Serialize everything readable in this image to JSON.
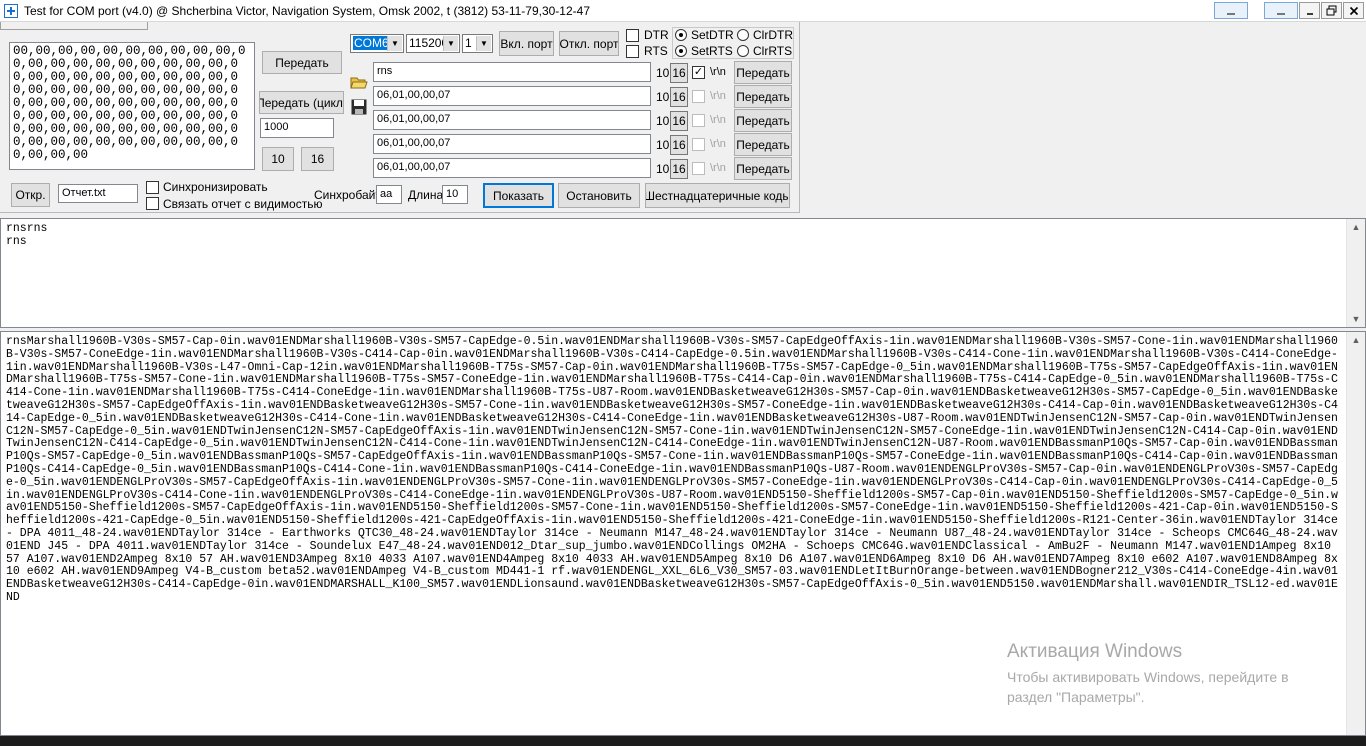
{
  "window": {
    "title": "Test for COM port (v4.0) @ Shcherbina Victor, Navigation System, Omsk 2002, t (3812) 53-11-79,30-12-47",
    "minimize_icon": "minimize-icon",
    "maximize_icon": "maximize-icon",
    "close_icon": "close-icon"
  },
  "send_block": {
    "hex_text": "00,00,00,00,00,00,00,00,00,00,00,00,00,00,00,00,00,00,00,00,00,00,00,00,00,00,00,00,00,00,00,00,00,00,00,00,00,00,00,00,00,00,00,00,00,00,00,00,00,00,00,00,00,00,00,00,00,00,00,00,00,00,00,00,00,00,00,00,00,00,00,00,00,00,00,00,00,00,00,00,00,00,00,00",
    "send_label": "Передать",
    "send_cycle_label": "Передать (цикл)",
    "cycle_interval": "1000",
    "dec_label": "10",
    "hex_label": "16"
  },
  "port": {
    "port_value": "COM6",
    "baud_value": "115200",
    "stopbits_value": "1",
    "connect_label": "Вкл. порт",
    "disconnect_label": "Откл. порт",
    "dtr_label": "DTR",
    "rts_label": "RTS",
    "setdtr_label": "SetDTR",
    "clrdtr_label": "ClrDTR",
    "setrts_label": "SetRTS",
    "clrrts_label": "ClrRTS"
  },
  "lines": {
    "rows": [
      {
        "value": "rns",
        "dec": "10",
        "hex": "16",
        "crlf": "\\r\\n",
        "checked": true,
        "send": "Передать"
      },
      {
        "value": "06,01,00,00,07",
        "dec": "10",
        "hex": "16",
        "crlf": "\\r\\n",
        "checked": false,
        "send": "Передать"
      },
      {
        "value": "06,01,00,00,07",
        "dec": "10",
        "hex": "16",
        "crlf": "\\r\\n",
        "checked": false,
        "send": "Передать"
      },
      {
        "value": "06,01,00,00,07",
        "dec": "10",
        "hex": "16",
        "crlf": "\\r\\n",
        "checked": false,
        "send": "Передать"
      },
      {
        "value": "06,01,00,00,07",
        "dec": "10",
        "hex": "16",
        "crlf": "\\r\\n",
        "checked": false,
        "send": "Передать"
      }
    ],
    "open_icon": "folder-open-icon",
    "save_icon": "floppy-save-icon"
  },
  "bottom_controls": {
    "open_label": "Откр.",
    "report_file": "Отчет.txt",
    "sync_label": "Синхронизировать",
    "link_label": "Связать отчет с видимостью",
    "syncbyte_label": "Синхробайт",
    "syncbyte_value": "aa",
    "length_label": "Длина",
    "length_value": "10",
    "show_label": "Показать",
    "stop_label": "Остановить",
    "hexcodes_label": "Шестнадцатеричные коды"
  },
  "output": {
    "mid_text": "rnsrns\nrns",
    "log_text": "rnsMarshall1960B-V30s-SM57-Cap-0in.wav01ENDMarshall1960B-V30s-SM57-CapEdge-0.5in.wav01ENDMarshall1960B-V30s-SM57-CapEdgeOffAxis-1in.wav01ENDMarshall1960B-V30s-SM57-Cone-1in.wav01ENDMarshall1960B-V30s-SM57-ConeEdge-1in.wav01ENDMarshall1960B-V30s-C414-Cap-0in.wav01ENDMarshall1960B-V30s-C414-CapEdge-0.5in.wav01ENDMarshall1960B-V30s-C414-Cone-1in.wav01ENDMarshall1960B-V30s-C414-ConeEdge-1in.wav01ENDMarshall1960B-V30s-L47-Omni-Cap-12in.wav01ENDMarshall1960B-T75s-SM57-Cap-0in.wav01ENDMarshall1960B-T75s-SM57-CapEdge-0_5in.wav01ENDMarshall1960B-T75s-SM57-CapEdgeOffAxis-1in.wav01ENDMarshall1960B-T75s-SM57-Cone-1in.wav01ENDMarshall1960B-T75s-SM57-ConeEdge-1in.wav01ENDMarshall1960B-T75s-C414-Cap-0in.wav01ENDMarshall1960B-T75s-C414-CapEdge-0_5in.wav01ENDMarshall1960B-T75s-C414-Cone-1in.wav01ENDMarshall1960B-T75s-C414-ConeEdge-1in.wav01ENDMarshall1960B-T75s-U87-Room.wav01ENDBasketweaveG12H30s-SM57-Cap-0in.wav01ENDBasketweaveG12H30s-SM57-CapEdge-0_5in.wav01ENDBasketweaveG12H30s-SM57-CapEdgeOffAxis-1in.wav01ENDBasketweaveG12H30s-SM57-Cone-1in.wav01ENDBasketweaveG12H30s-SM57-ConeEdge-1in.wav01ENDBasketweaveG12H30s-C414-Cap-0in.wav01ENDBasketweaveG12H30s-C414-CapEdge-0_5in.wav01ENDBasketweaveG12H30s-C414-Cone-1in.wav01ENDBasketweaveG12H30s-C414-ConeEdge-1in.wav01ENDBasketweaveG12H30s-U87-Room.wav01ENDTwinJensenC12N-SM57-Cap-0in.wav01ENDTwinJensenC12N-SM57-CapEdge-0_5in.wav01ENDTwinJensenC12N-SM57-CapEdgeOffAxis-1in.wav01ENDTwinJensenC12N-SM57-Cone-1in.wav01ENDTwinJensenC12N-SM57-ConeEdge-1in.wav01ENDTwinJensenC12N-C414-Cap-0in.wav01ENDTwinJensenC12N-C414-CapEdge-0_5in.wav01ENDTwinJensenC12N-C414-Cone-1in.wav01ENDTwinJensenC12N-C414-ConeEdge-1in.wav01ENDTwinJensenC12N-U87-Room.wav01ENDBassmanP10Qs-SM57-Cap-0in.wav01ENDBassmanP10Qs-SM57-CapEdge-0_5in.wav01ENDBassmanP10Qs-SM57-CapEdgeOffAxis-1in.wav01ENDBassmanP10Qs-SM57-Cone-1in.wav01ENDBassmanP10Qs-SM57-ConeEdge-1in.wav01ENDBassmanP10Qs-C414-Cap-0in.wav01ENDBassmanP10Qs-C414-CapEdge-0_5in.wav01ENDBassmanP10Qs-C414-Cone-1in.wav01ENDBassmanP10Qs-C414-ConeEdge-1in.wav01ENDBassmanP10Qs-U87-Room.wav01ENDENGLProV30s-SM57-Cap-0in.wav01ENDENGLProV30s-SM57-CapEdge-0_5in.wav01ENDENGLProV30s-SM57-CapEdgeOffAxis-1in.wav01ENDENGLProV30s-SM57-Cone-1in.wav01ENDENGLProV30s-SM57-ConeEdge-1in.wav01ENDENGLProV30s-C414-Cap-0in.wav01ENDENGLProV30s-C414-CapEdge-0_5in.wav01ENDENGLProV30s-C414-Cone-1in.wav01ENDENGLProV30s-C414-ConeEdge-1in.wav01ENDENGLProV30s-U87-Room.wav01END5150-Sheffield1200s-SM57-Cap-0in.wav01END5150-Sheffield1200s-SM57-CapEdge-0_5in.wav01END5150-Sheffield1200s-SM57-CapEdgeOffAxis-1in.wav01END5150-Sheffield1200s-SM57-Cone-1in.wav01END5150-Sheffield1200s-SM57-ConeEdge-1in.wav01END5150-Sheffield1200s-421-Cap-0in.wav01END5150-Sheffield1200s-421-CapEdge-0_5in.wav01END5150-Sheffield1200s-421-CapEdgeOffAxis-1in.wav01END5150-Sheffield1200s-421-ConeEdge-1in.wav01END5150-Sheffield1200s-R121-Center-36in.wav01ENDTaylor 314ce - DPA 4011_48-24.wav01ENDTaylor 314ce - Earthworks QTC30_48-24.wav01ENDTaylor 314ce - Neumann M147_48-24.wav01ENDTaylor 314ce - Neumann U87_48-24.wav01ENDTaylor 314ce - Scheops CMC64G_48-24.wav01END J45 - DPA 4011.wav01ENDTaylor 314ce - Soundelux E47_48-24.wav01END012_Dtar_sup_jumbo.wav01ENDCollings OM2HA - Schoeps CMC64G.wav01ENDClassical - AmBu2F - Neumann M147.wav01END1Ampeg 8x10 57 A107.wav01END2Ampeg 8x10 57 AH.wav01END3Ampeg 8x10 4033 A107.wav01END4Ampeg 8x10 4033 AH.wav01END5Ampeg 8x10 D6 A107.wav01END6Ampeg 8x10 D6 AH.wav01END7Ampeg 8x10 e602 A107.wav01END8Ampeg 8x10 e602 AH.wav01END9Ampeg V4-B_custom beta52.wav01ENDAmpeg V4-B_custom MD441-1 rf.wav01ENDENGL_XXL_6L6_V30_SM57-03.wav01ENDLetItBurnOrange-between.wav01ENDBogner212_V30s-C414-ConeEdge-4in.wav01ENDBasketweaveG12H30s-C414-CapEdge-0in.wav01ENDMARSHALL_K100_SM57.wav01ENDLionsaund.wav01ENDBasketweaveG12H30s-SM57-CapEdgeOffAxis-0_5in.wav01END5150.wav01ENDMarshall.wav01ENDIR_TSL12-ed.wav01END"
  },
  "watermark": {
    "title": "Активация Windows",
    "line1": "Чтобы активировать Windows, перейдите в",
    "line2": "раздел \"Параметры\"."
  }
}
